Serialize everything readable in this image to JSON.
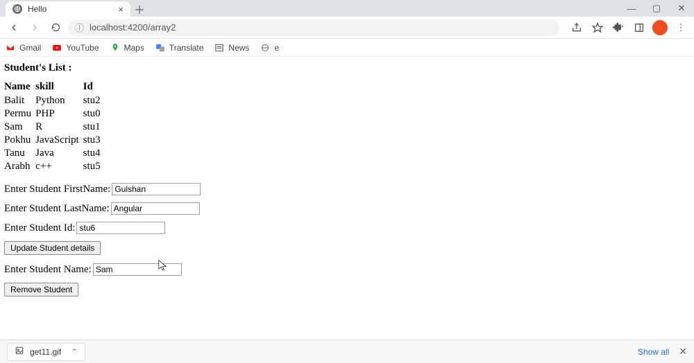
{
  "browser": {
    "tab_title": "Hello",
    "url_display": "localhost:4200/array2",
    "bookmarks": [
      {
        "label": "Gmail"
      },
      {
        "label": "YouTube"
      },
      {
        "label": "Maps"
      },
      {
        "label": "Translate"
      },
      {
        "label": "News"
      },
      {
        "label": "e"
      }
    ]
  },
  "page": {
    "heading": "Student's List :",
    "columns": {
      "c0": "Name",
      "c1": "skill",
      "c2": "Id"
    },
    "rows": [
      {
        "name": "Balit",
        "skill": "Python",
        "id": "stu2"
      },
      {
        "name": "Permu",
        "skill": "PHP",
        "id": "stu0"
      },
      {
        "name": "Sam",
        "skill": "R",
        "id": "stu1"
      },
      {
        "name": "Pokhu",
        "skill": "JavaScript",
        "id": "stu3"
      },
      {
        "name": "Tanu",
        "skill": "Java",
        "id": "stu4"
      },
      {
        "name": "Arabh",
        "skill": "c++",
        "id": "stu5"
      }
    ],
    "form": {
      "firstname_label": "Enter Student FirstName:",
      "firstname_value": "Gulshan",
      "lastname_label": "Enter Student LastName:",
      "lastname_value": "Angular",
      "id_label": "Enter Student Id:",
      "id_value": "stu6",
      "update_btn": "Update Student details",
      "name_label": "Enter Student Name:",
      "name_value": "Sam",
      "remove_btn": "Remove Student"
    }
  },
  "download": {
    "file": "get11.gif",
    "show_all": "Show all"
  }
}
